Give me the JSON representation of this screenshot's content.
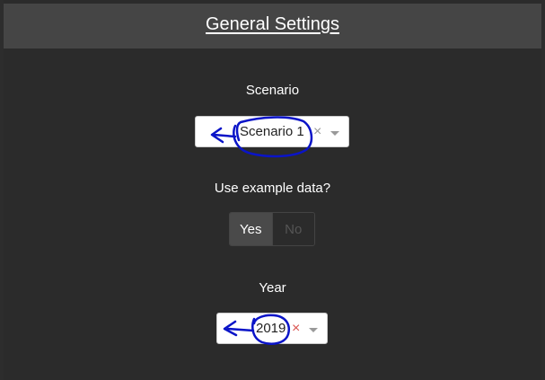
{
  "header": {
    "title": "General Settings"
  },
  "scenario": {
    "label": "Scenario",
    "value": "Scenario 1",
    "clear_symbol": "×",
    "clear_color": "#999999"
  },
  "example_data": {
    "label": "Use example data?",
    "options": [
      "Yes",
      "No"
    ],
    "selected": "Yes"
  },
  "year": {
    "label": "Year",
    "value": "2019",
    "clear_symbol": "×",
    "clear_color": "#d9534f"
  },
  "annotation_color": "#0a14c8"
}
